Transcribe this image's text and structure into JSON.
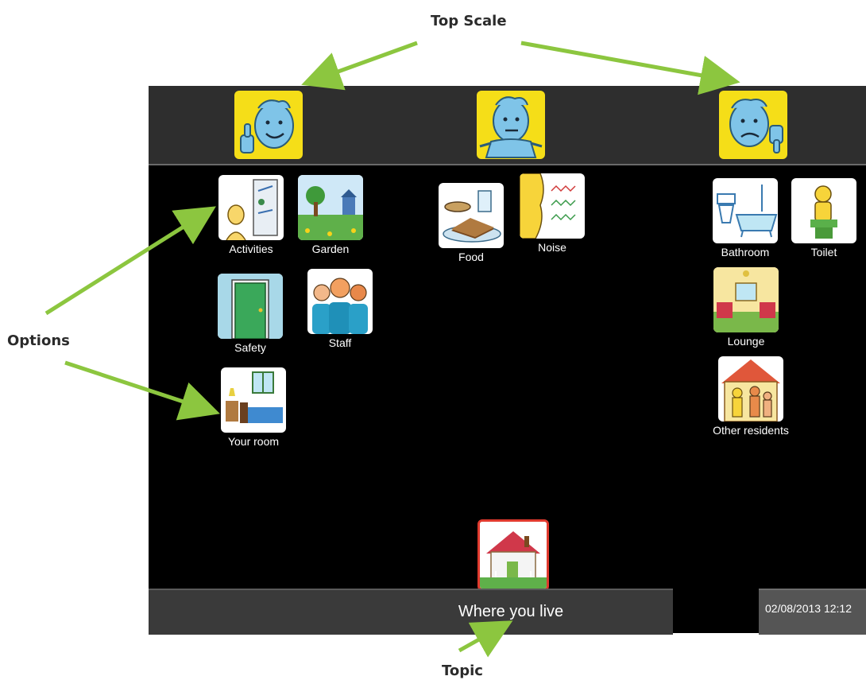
{
  "annotations": {
    "top_scale": "Top Scale",
    "options": "Options",
    "topic": "Topic"
  },
  "scale": [
    {
      "mood": "happy",
      "icon": "thumbs-up-face-icon"
    },
    {
      "mood": "neutral",
      "icon": "shrug-face-icon"
    },
    {
      "mood": "sad",
      "icon": "thumbs-down-face-icon"
    }
  ],
  "options": {
    "activities": "Activities",
    "garden": "Garden",
    "safety": "Safety",
    "staff": "Staff",
    "your_room": "Your room",
    "food": "Food",
    "noise": "Noise",
    "bathroom": "Bathroom",
    "toilet": "Toilet",
    "lounge": "Lounge",
    "other_residents": "Other residents"
  },
  "topic": {
    "label": "Where you live",
    "icon": "house-icon"
  },
  "status": {
    "datetime": "02/08/2013 12:12"
  },
  "colors": {
    "scale_yellow": "#f5de18",
    "arrow_green": "#8cc63f",
    "topic_border": "#e03a2e"
  }
}
